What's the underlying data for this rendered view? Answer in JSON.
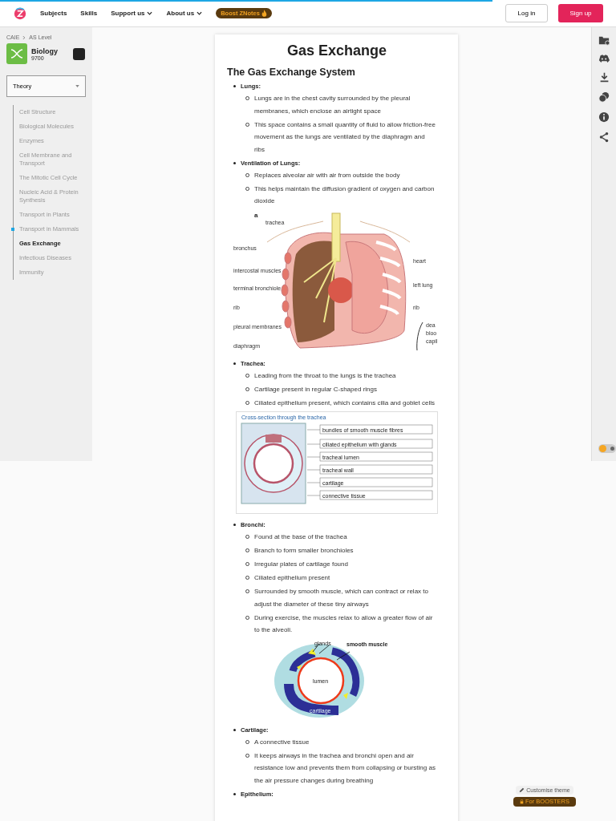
{
  "header": {
    "progress": {
      "level": 0.8
    },
    "nav": [
      {
        "label": "Subjects",
        "dropdown": false
      },
      {
        "label": "Skills",
        "dropdown": false
      },
      {
        "label": "Support us",
        "dropdown": true
      },
      {
        "label": "About us",
        "dropdown": true
      }
    ],
    "boost": "Boost ZNotes",
    "login": "Log in",
    "signup": "Sign up"
  },
  "sidebar": {
    "breadcrumb": [
      "CAIE",
      "AS Level"
    ],
    "subject": "Biology",
    "code": "9700",
    "dropdown": "Theory",
    "items": [
      {
        "label": "Cell Structure",
        "selected": false,
        "marked": false
      },
      {
        "label": "Biological Molecules",
        "selected": false,
        "marked": false
      },
      {
        "label": "Enzymes",
        "selected": false,
        "marked": false
      },
      {
        "label": "Cell Membrane and Transport",
        "selected": false,
        "marked": false
      },
      {
        "label": "The Mitotic Cell Cycle",
        "selected": false,
        "marked": false
      },
      {
        "label": "Nucleic Acid & Protein Synthesis",
        "selected": false,
        "marked": false
      },
      {
        "label": "Transport in Plants",
        "selected": false,
        "marked": false
      },
      {
        "label": "Transport in Mammals",
        "selected": false,
        "marked": true
      },
      {
        "label": "Gas Exchange",
        "selected": true,
        "marked": false
      },
      {
        "label": "Infectious Diseases",
        "selected": false,
        "marked": false
      },
      {
        "label": "Immunity",
        "selected": false,
        "marked": false
      }
    ]
  },
  "article": {
    "title": "Gas Exchange",
    "heading": "The Gas Exchange System",
    "blocks": [
      {
        "kind": "point",
        "label": "Lungs:",
        "items": [
          "Lungs are in the chest cavity surrounded by the pleural membranes, which enclose an airtight space",
          "This space contains a small quantity of fluid to allow friction-free movement as the lungs are ventilated by the diaphragm and ribs"
        ]
      },
      {
        "kind": "point",
        "label": "Ventilation of Lungs:",
        "items": [
          "Replaces alveolar air with air from outside the body",
          "This helps maintain the diffusion gradient of oxygen and carbon dioxide"
        ]
      },
      {
        "kind": "lungs",
        "mark": "a",
        "labels": [
          "trachea",
          "bronchus",
          "intercostal muscles",
          "terminal bronchiole",
          "rib",
          "pleural membranes",
          "diaphragm",
          "heart",
          "left lung",
          "rib",
          "dea",
          "bloo",
          "capil"
        ]
      },
      {
        "kind": "point",
        "label": "Trachea:",
        "items": [
          "Leading from the throat to the lungs is the trachea",
          "Cartilage present in regular C-shaped rings",
          "Ciliated epithelium present, which contains cilia and goblet cells"
        ]
      },
      {
        "kind": "trachea",
        "title": "Cross-section through the trachea",
        "labels": [
          "bundles of smooth muscle fibres",
          "ciliated epithelium with glands",
          "tracheal lumen",
          "tracheal wall",
          "cartilage",
          "connective tissue"
        ]
      },
      {
        "kind": "point",
        "label": "Bronchi:",
        "items": [
          "Found at the base of the trachea",
          "Branch to form smaller bronchioles",
          "Irregular plates of cartilage found",
          "Ciliated epithelium present",
          "Surrounded by smooth muscle, which can contract or relax to adjust the diameter of these tiny airways",
          "During exercise, the muscles relax to allow a greater flow of air to the alveoli."
        ]
      },
      {
        "kind": "bronchus",
        "labels": [
          "glands",
          "smooth muscle",
          "lumen",
          "cartilage"
        ]
      },
      {
        "kind": "point",
        "label": "Cartilage:",
        "items": [
          "A connective tissue",
          "It keeps airways in the trachea and bronchi open and air resistance low and prevents them from collapsing or bursting as the air pressure changes during breathing"
        ]
      },
      {
        "kind": "point",
        "label": "Epithelium:"
      }
    ]
  },
  "theme": {
    "dark": false,
    "customise": "Customise theme",
    "boosters": "For BOOSTERS"
  }
}
